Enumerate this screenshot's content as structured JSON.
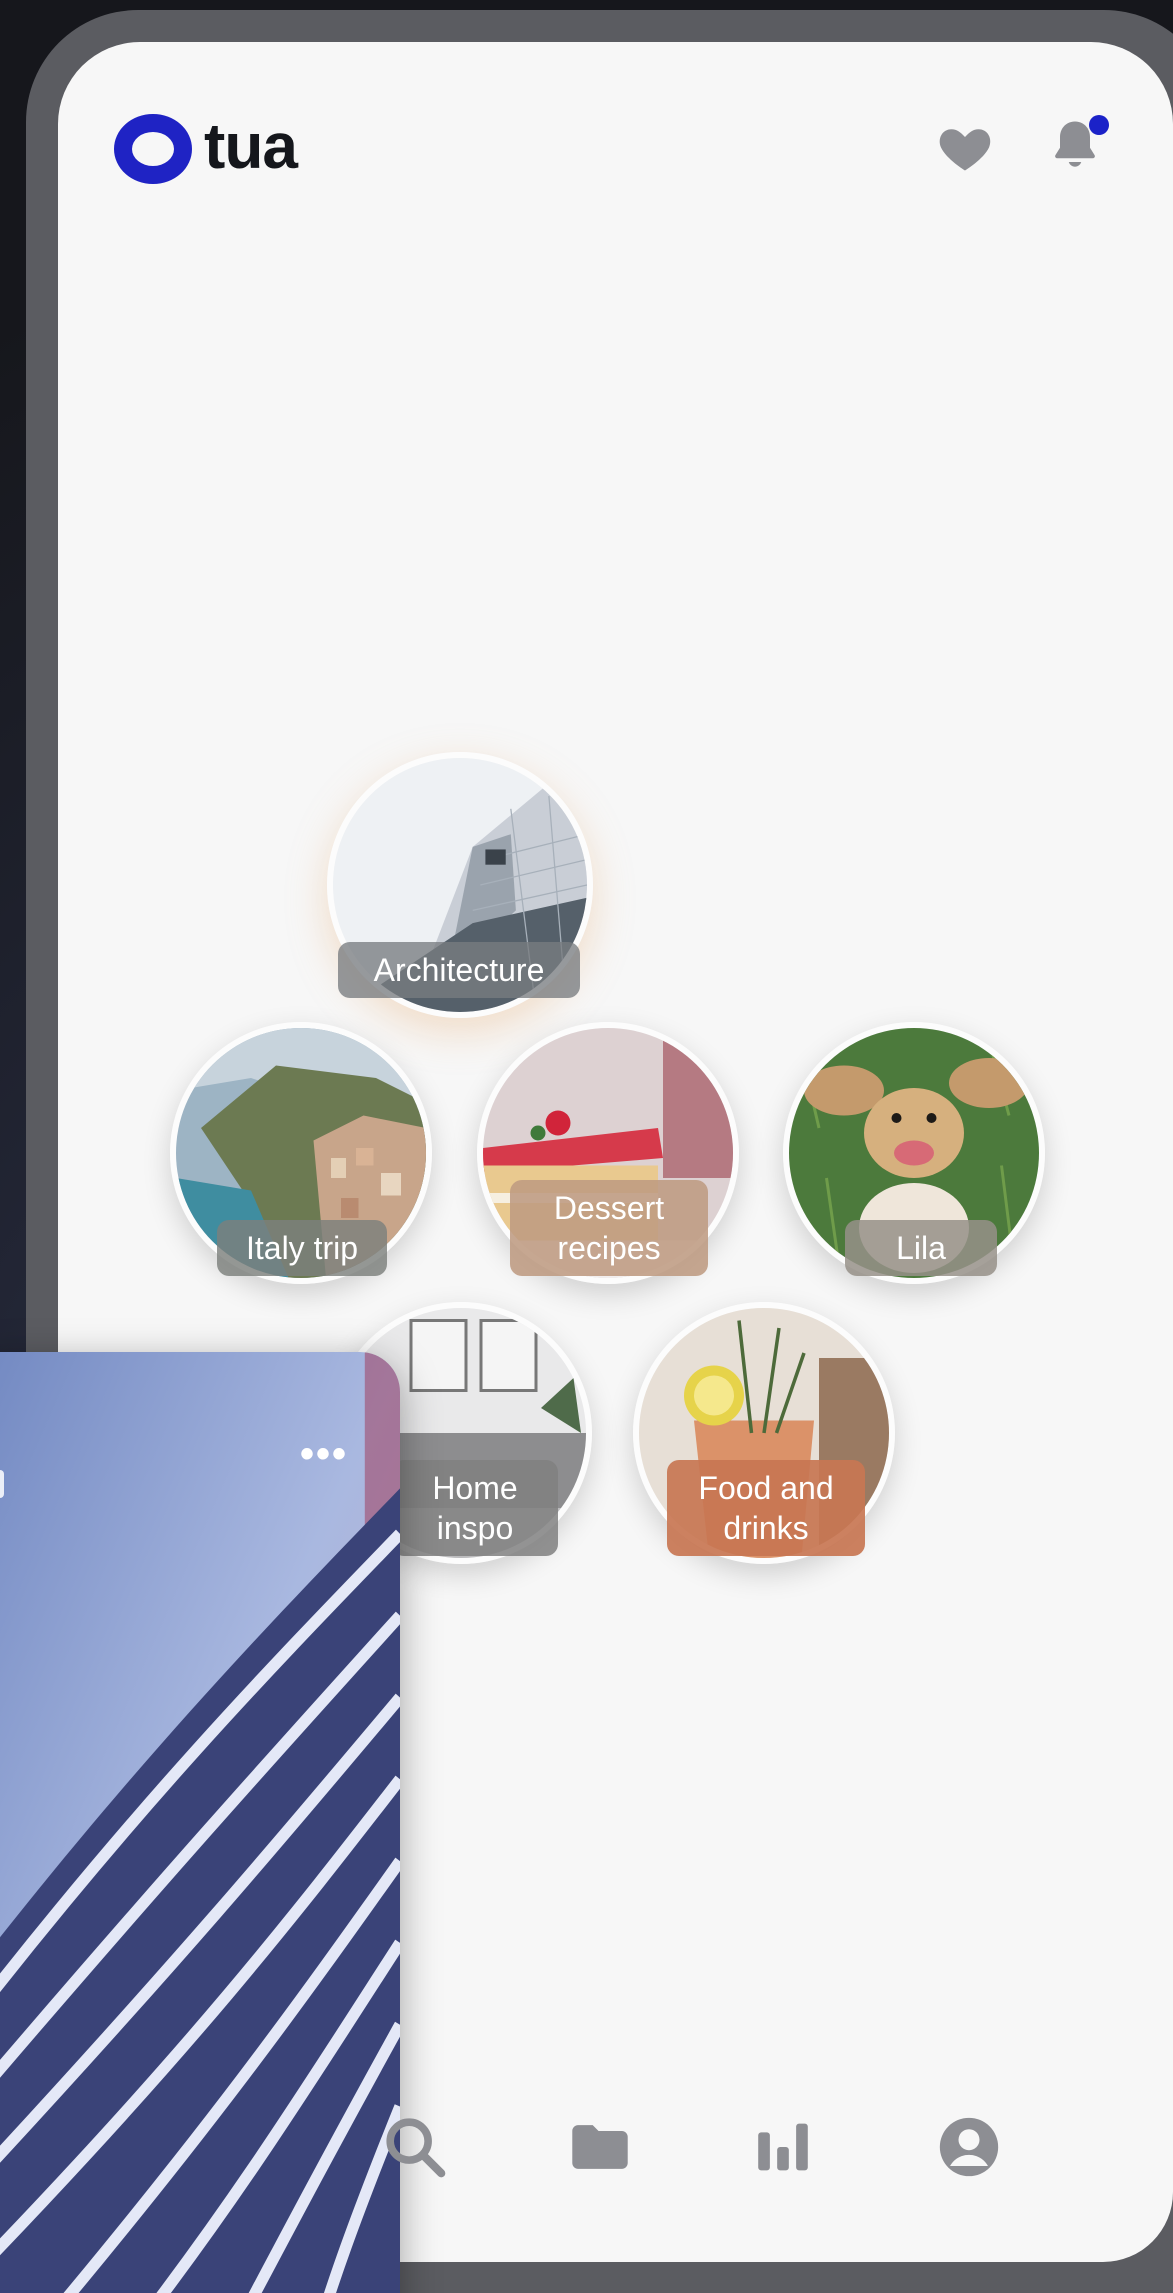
{
  "app": {
    "name": "tua"
  },
  "header": {
    "logo_text": "tua",
    "favorites_icon": "heart-icon",
    "notifications_icon": "bell-icon",
    "has_unread_notifications": true,
    "accent_color": "#1f23c4"
  },
  "collections": [
    {
      "label": "Architecture",
      "image": "architecture-building-photo"
    },
    {
      "label": "Italy trip",
      "image": "italy-coast-photo"
    },
    {
      "label": "Dessert recipes",
      "image": "cake-photo"
    },
    {
      "label": "Lila",
      "image": "dog-photo"
    },
    {
      "label": "Home inspo",
      "image": "interior-photo"
    },
    {
      "label": "Food and drinks",
      "image": "cocktail-photo"
    }
  ],
  "card": {
    "more_label": "•••",
    "image": "curved-building-facade-photo"
  },
  "bottom_nav": [
    {
      "icon": "search-icon"
    },
    {
      "icon": "folder-icon"
    },
    {
      "icon": "stats-icon"
    },
    {
      "icon": "profile-icon"
    }
  ]
}
